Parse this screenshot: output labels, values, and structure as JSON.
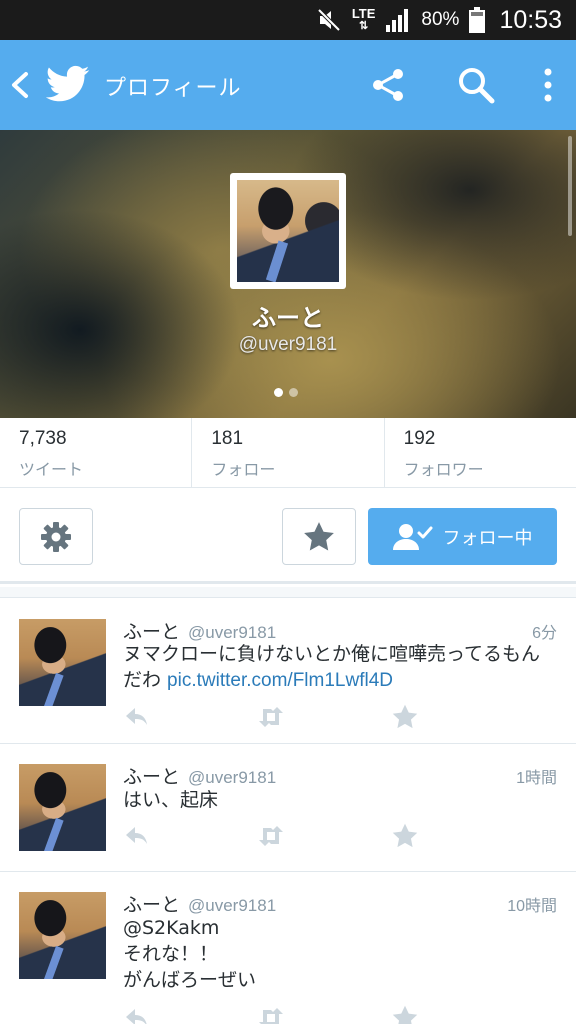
{
  "status_bar": {
    "network": "LTE",
    "battery": "80%",
    "time": "10:53"
  },
  "app_bar": {
    "title": "プロフィール",
    "icons": [
      "back-icon",
      "twitter-bird-icon",
      "share-icon",
      "search-icon",
      "more-vert-icon"
    ]
  },
  "profile": {
    "name": "ふーと",
    "handle": "@uver9181"
  },
  "stats": [
    {
      "value": "7,738",
      "label": "ツイート"
    },
    {
      "value": "181",
      "label": "フォロー"
    },
    {
      "value": "192",
      "label": "フォロワー"
    }
  ],
  "actions": {
    "follow_label": "フォロー中"
  },
  "colors": {
    "brand": "#55acee",
    "link": "#2b7bb9",
    "muted": "#8899a6"
  },
  "tweets": [
    {
      "name": "ふーと",
      "handle": "@uver9181",
      "time": "6分",
      "text": "ヌマクローに負けないとか俺に喧嘩売ってるもん\nだわ ",
      "link": "pic.twitter.com/Flm1Lwfl4D"
    },
    {
      "name": "ふーと",
      "handle": "@uver9181",
      "time": "1時間",
      "text": "はい、起床",
      "link": ""
    },
    {
      "name": "ふーと",
      "handle": "@uver9181",
      "time": "10時間",
      "text": "@S2Kakm\nそれな！！\nがんばろーぜい",
      "link": ""
    }
  ]
}
